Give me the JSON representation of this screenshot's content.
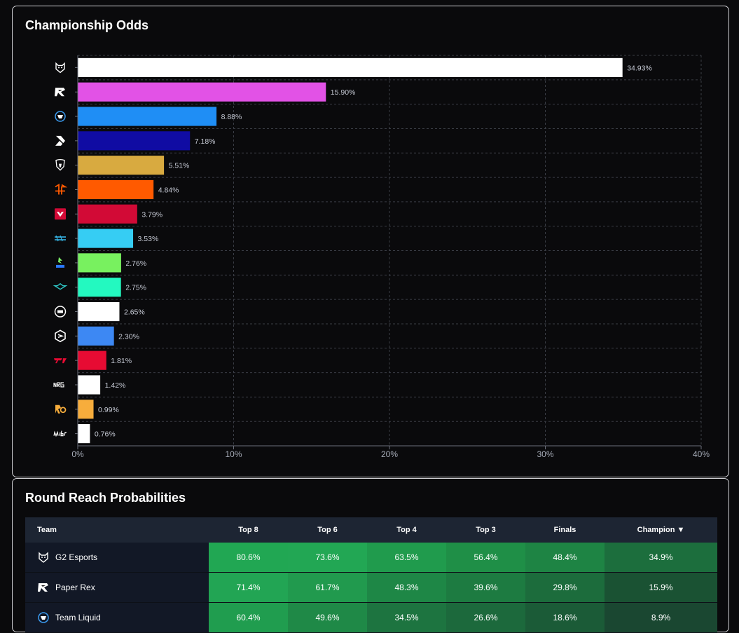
{
  "chart_card": {
    "title": "Championship Odds"
  },
  "chart_data": {
    "type": "bar",
    "orientation": "horizontal",
    "categories": [
      "G2 Esports",
      "Paper Rex",
      "Team Liquid",
      "DRX",
      "Team Heretics",
      "FNATIC",
      "Sentinels",
      "Leviatán",
      "DRG",
      "Rex Regum Qeon",
      "EDward Gaming",
      "Paper/Shape",
      "T1",
      "NRG",
      "Rex Regum Qeon 2",
      "MIBR"
    ],
    "category_icons": [
      "g2-logo-icon",
      "paper-rex-logo-icon",
      "liquid-logo-icon",
      "drx-logo-icon",
      "heretics-logo-icon",
      "fnatic-logo-icon",
      "sentinels-logo-icon",
      "leviatan-logo-icon",
      "drg-logo-icon",
      "wing-logo-icon",
      "edg-logo-icon",
      "hex-logo-icon",
      "t1-logo-icon",
      "nrg-logo-icon",
      "rrq-logo-icon",
      "mibr-logo-icon"
    ],
    "values": [
      34.93,
      15.9,
      8.88,
      7.18,
      5.51,
      4.84,
      3.79,
      3.53,
      2.76,
      2.75,
      2.65,
      2.3,
      1.81,
      1.42,
      0.99,
      0.76
    ],
    "value_labels": [
      "34.93%",
      "15.90%",
      "8.88%",
      "7.18%",
      "5.51%",
      "4.84%",
      "3.79%",
      "3.53%",
      "2.76%",
      "2.75%",
      "2.65%",
      "2.30%",
      "1.81%",
      "1.42%",
      "0.99%",
      "0.76%"
    ],
    "colors": [
      "#ffffff",
      "#e252e6",
      "#1f8ef5",
      "#100ca3",
      "#d8aa40",
      "#ff5a00",
      "#d20a36",
      "#36cdf3",
      "#78f15f",
      "#23f9c0",
      "#ffffff",
      "#3d88f3",
      "#e70b33",
      "#ffffff",
      "#f7ad3c",
      "#ffffff"
    ],
    "xlim": [
      0,
      40
    ],
    "xticks": [
      0,
      10,
      20,
      30,
      40
    ],
    "xtick_labels": [
      "0%",
      "10%",
      "20%",
      "30%",
      "40%"
    ],
    "grid": true,
    "xlabel": "",
    "ylabel": ""
  },
  "round_card": {
    "title": "Round Reach Probabilities",
    "columns": [
      "Team",
      "Top 8",
      "Top 6",
      "Top 4",
      "Top 3",
      "Finals",
      "Champion ▼"
    ],
    "rows": [
      {
        "team": "G2 Esports",
        "icon": "g2-logo-icon",
        "cells": [
          "80.6%",
          "73.6%",
          "63.5%",
          "56.4%",
          "48.4%",
          "34.9%"
        ],
        "colors": [
          "#21a753",
          "#22a754",
          "#209b4d",
          "#1f8f47",
          "#1e8444",
          "#1c6e3d"
        ]
      },
      {
        "team": "Paper Rex",
        "icon": "paper-rex-logo-icon",
        "cells": [
          "71.4%",
          "61.7%",
          "48.3%",
          "39.6%",
          "29.8%",
          "15.9%"
        ],
        "colors": [
          "#22a554",
          "#219a4e",
          "#1e8746",
          "#1d7b41",
          "#1c6c3c",
          "#1a5233"
        ]
      },
      {
        "team": "Team Liquid",
        "icon": "liquid-logo-icon",
        "cells": [
          "60.4%",
          "49.6%",
          "34.5%",
          "26.6%",
          "18.6%",
          "8.9%"
        ],
        "colors": [
          "#209d4f",
          "#1f8947",
          "#1d7440",
          "#1c693c",
          "#1b5b37",
          "#1a4731"
        ]
      }
    ]
  }
}
